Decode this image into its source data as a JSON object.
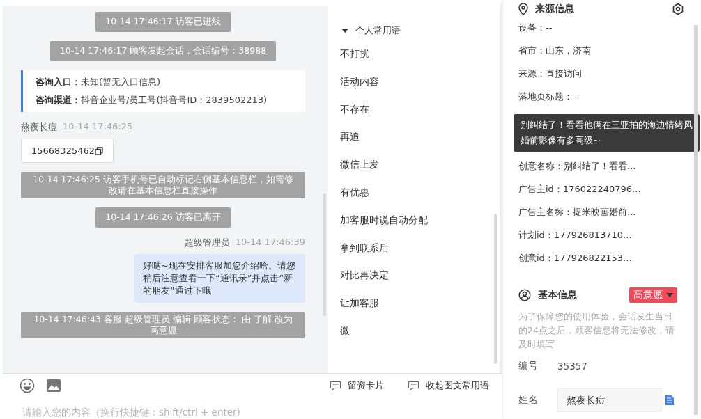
{
  "chat": {
    "messages": [
      {
        "kind": "system",
        "text": "10-14 17:46:17 访客已进线"
      },
      {
        "kind": "system",
        "text": "10-14 17:46:17 顾客发起会话，会话编号：38988"
      },
      {
        "kind": "info",
        "lines": [
          {
            "label": "咨询入口：",
            "value": "未知(暂无入口信息)"
          },
          {
            "label": "咨询渠道：",
            "value": "抖音企业号/员工号(抖音号ID：2839502213)"
          }
        ]
      },
      {
        "kind": "incoming",
        "sender": "熬夜长痘",
        "time": "10-14 17:46:25",
        "text": "15668325462"
      },
      {
        "kind": "system_wide",
        "text": "10-14 17:46:25 访客手机号已自动标记右侧基本信息栏，如需修改请在基本信息栏直接操作"
      },
      {
        "kind": "system",
        "text": "10-14 17:46:26 访客已离开"
      },
      {
        "kind": "outgoing",
        "sender": "超级管理员",
        "time": "10-14 17:46:39",
        "text": "好哒~现在安排客服加您介绍哈。请您稍后注意查看一下“通讯录”并点击“新的朋友”通过下哦"
      },
      {
        "kind": "system_wide",
        "text": "10-14 17:46:43 客服 超级管理员 编辑 顾客状态： 由 了解 改为高意愿"
      }
    ]
  },
  "phrases": {
    "group": {
      "label": "个人常用语",
      "expanded": true
    },
    "items": [
      "不打扰",
      "活动内容",
      "不存在",
      "再追",
      "微信上发",
      "有优惠",
      "加客服时说自动分配",
      "拿到联系后",
      "对比再决定",
      "让加客服",
      "微"
    ]
  },
  "toolbar": {
    "buttons": [
      "留资卡片",
      "收起图文常用语"
    ]
  },
  "input": {
    "placeholder": "请输入您的内容（换行快捷键：shift/ctrl + enter)"
  },
  "source": {
    "title": "来源信息",
    "rows_top": [
      "设备：--",
      "省市：山东，济南",
      "来源：直接访问",
      "落地页标题：--"
    ],
    "tooltip": "别纠结了！看看他俩在三亚拍的海边情绪风婚前影像有多高级~",
    "rows_bottom": [
      "创意名称：别纠结了！看看...",
      "广告主id：176022240796...",
      "广告主名称：提米映画婚前...",
      "计划id：177926813710...",
      "创意id：177926822153..."
    ]
  },
  "basic": {
    "title": "基本信息",
    "tag": "高意愿",
    "note": "为了保障您的使用体验，会话发生当日的24点之后，顾客信息将无法修改，请及时填写",
    "fields": [
      {
        "kind": "text",
        "label": "编号",
        "value": "35357"
      },
      {
        "kind": "input",
        "label": "姓名",
        "value": "熬夜长痘"
      }
    ]
  }
}
